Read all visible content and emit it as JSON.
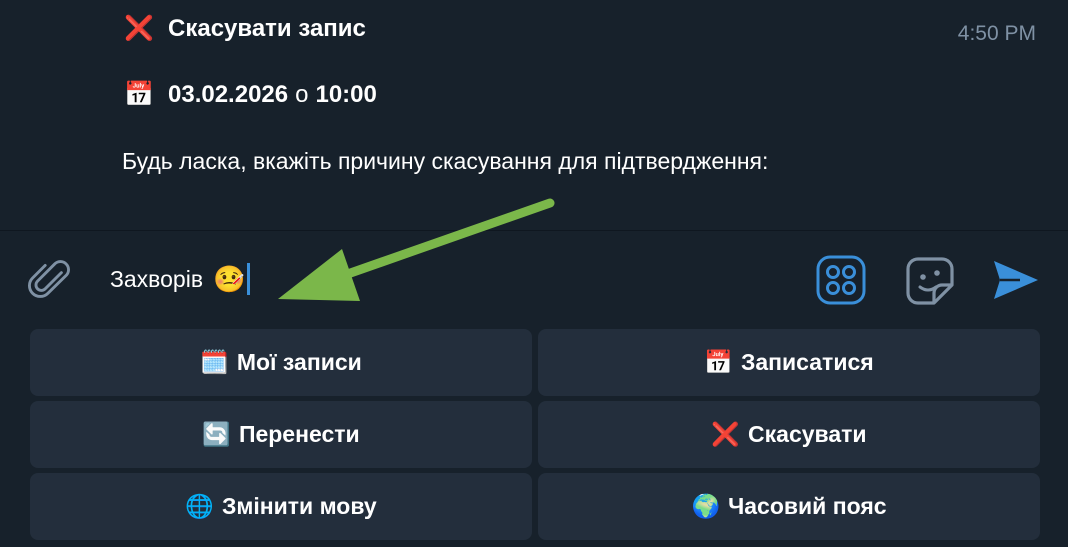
{
  "message": {
    "title_emoji": "❌",
    "title": "Скасувати запис",
    "timestamp": "4:50 PM",
    "date_emoji": "📅",
    "date": "03.02.2026",
    "date_sep": "о",
    "time": "10:00",
    "instruction": "Будь ласка, вкажіть причину скасування для підтвердження:"
  },
  "input": {
    "value": "Захворів",
    "emoji": "🤒"
  },
  "icons": {
    "attach": "paperclip-icon",
    "commands": "bot-menu-icon",
    "sticker": "sticker-icon",
    "send": "send-icon",
    "accent": "#3a8fd9",
    "arrow_color": "#7bb74a"
  },
  "keyboard": {
    "rows": [
      [
        {
          "emoji": "🗓️",
          "label": "Мої записи"
        },
        {
          "emoji": "📅",
          "label": "Записатися"
        }
      ],
      [
        {
          "emoji": "🔄",
          "label": "Перенести"
        },
        {
          "emoji": "❌",
          "label": "Скасувати"
        }
      ],
      [
        {
          "emoji": "🌐",
          "label": "Змінити мову"
        },
        {
          "emoji": "🌍",
          "label": "Часовий пояс"
        }
      ]
    ]
  }
}
